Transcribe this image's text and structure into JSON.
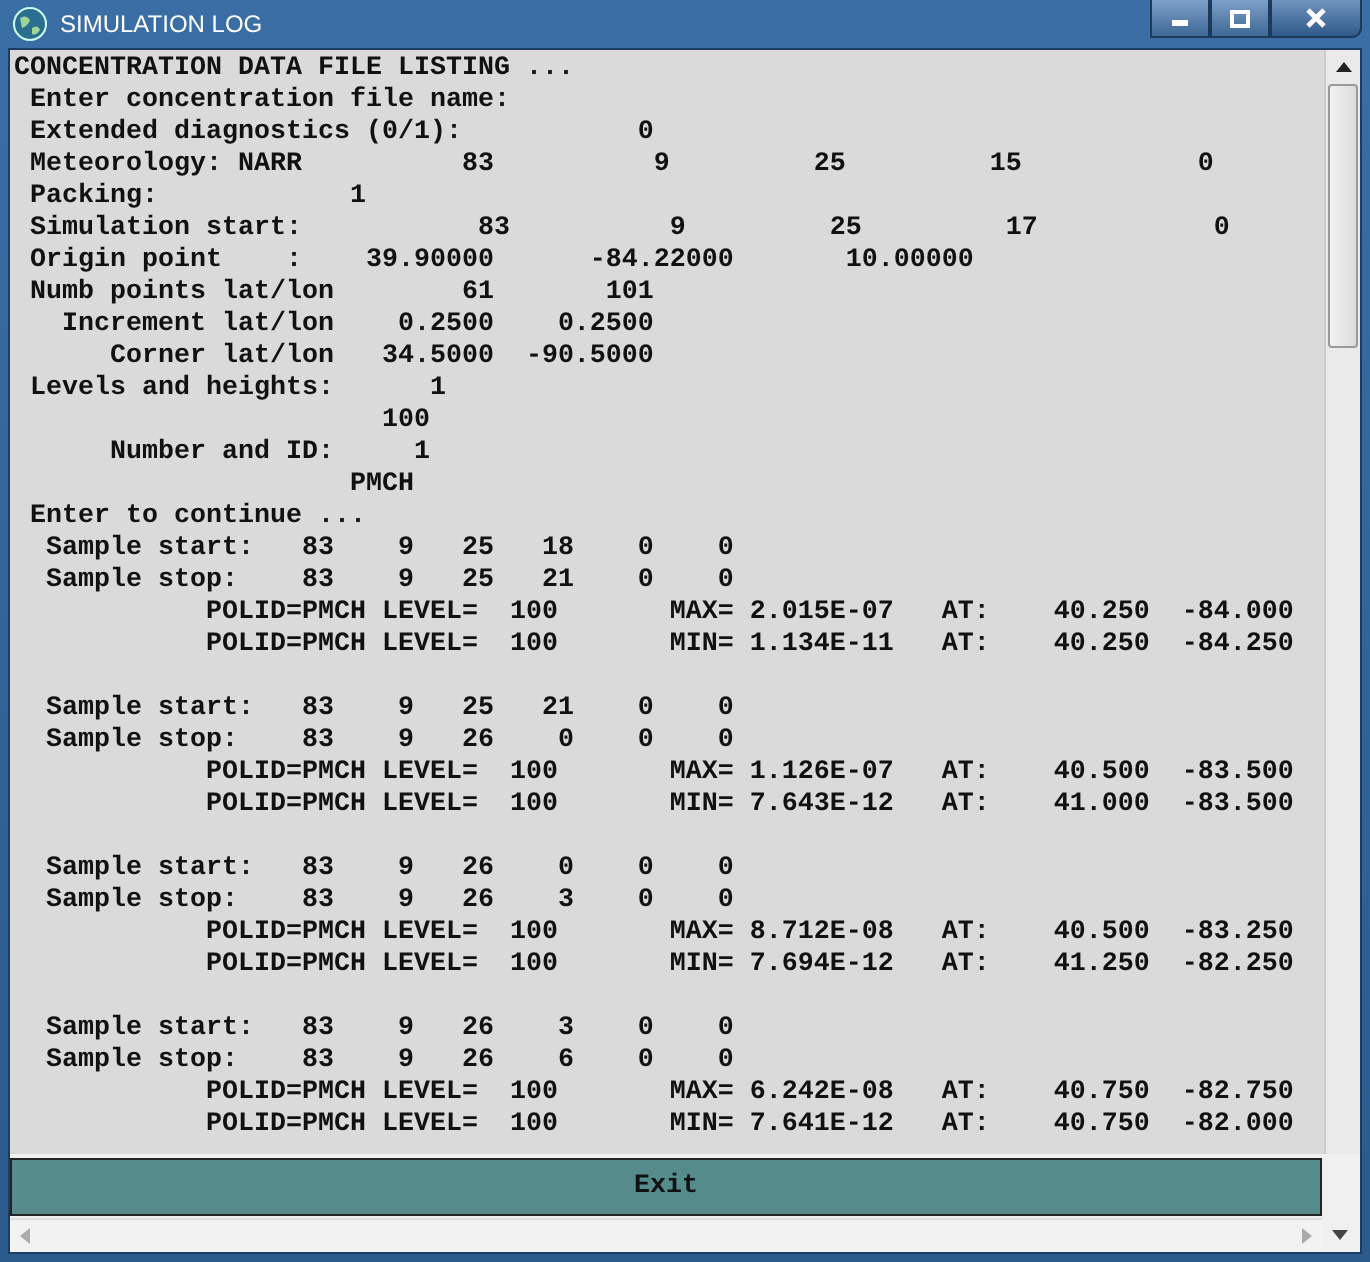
{
  "window": {
    "title": "SIMULATION LOG"
  },
  "log": {
    "header_lines": [
      "CONCENTRATION DATA FILE LISTING ...",
      " Enter concentration file name:",
      " Extended diagnostics (0/1):           0",
      " Meteorology: NARR          83          9         25         15           0",
      " Packing:            1",
      " Simulation start:           83          9         25         17           0",
      " Origin point    :    39.90000      -84.22000       10.00000",
      " Numb points lat/lon        61       101",
      "   Increment lat/lon    0.2500    0.2500",
      "      Corner lat/lon   34.5000  -90.5000",
      " Levels and heights:      1",
      "                       100",
      "      Number and ID:     1",
      "                     PMCH",
      " Enter to continue ..."
    ],
    "samples": [
      {
        "lines": [
          "  Sample start:   83    9   25   18    0    0",
          "  Sample stop:    83    9   25   21    0    0",
          "            POLID=PMCH LEVEL=  100       MAX= 2.015E-07   AT:    40.250  -84.000",
          "            POLID=PMCH LEVEL=  100       MIN= 1.134E-11   AT:    40.250  -84.250"
        ]
      },
      {
        "lines": [
          "  Sample start:   83    9   25   21    0    0",
          "  Sample stop:    83    9   26    0    0    0",
          "            POLID=PMCH LEVEL=  100       MAX= 1.126E-07   AT:    40.500  -83.500",
          "            POLID=PMCH LEVEL=  100       MIN= 7.643E-12   AT:    41.000  -83.500"
        ]
      },
      {
        "lines": [
          "  Sample start:   83    9   26    0    0    0",
          "  Sample stop:    83    9   26    3    0    0",
          "            POLID=PMCH LEVEL=  100       MAX= 8.712E-08   AT:    40.500  -83.250",
          "            POLID=PMCH LEVEL=  100       MIN= 7.694E-12   AT:    41.250  -82.250"
        ]
      },
      {
        "lines": [
          "  Sample start:   83    9   26    3    0    0",
          "  Sample stop:    83    9   26    6    0    0",
          "            POLID=PMCH LEVEL=  100       MAX= 6.242E-08   AT:    40.750  -82.750",
          "            POLID=PMCH LEVEL=  100       MIN= 7.641E-12   AT:    40.750  -82.000"
        ]
      }
    ]
  },
  "exit_button": {
    "label": "Exit"
  }
}
